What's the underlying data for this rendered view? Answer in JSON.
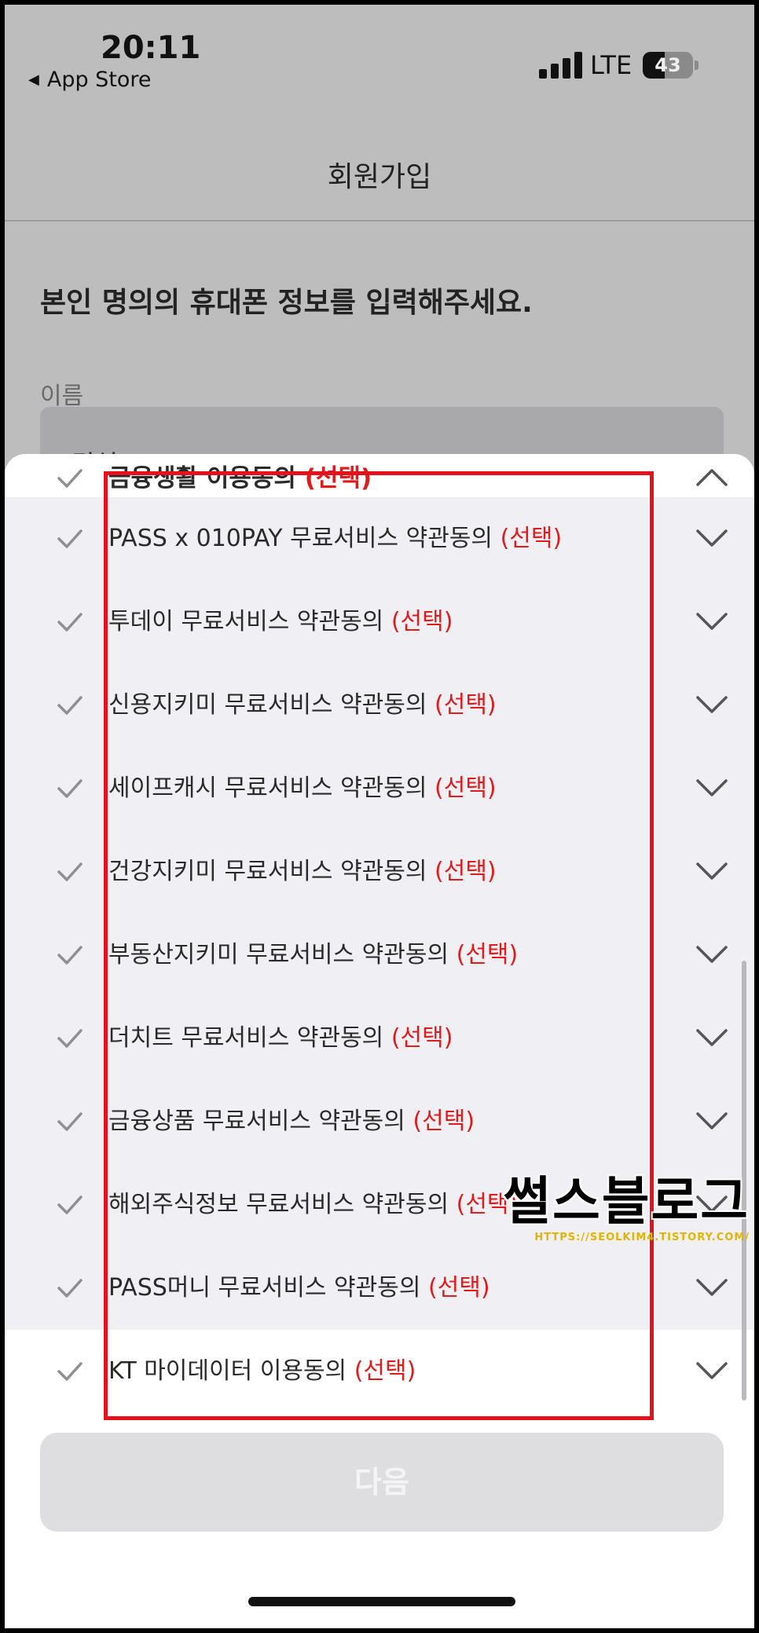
{
  "status_bar": {
    "time": "20:11",
    "back_app": "App Store",
    "network": "LTE",
    "battery": "43",
    "battery_level_percent": 43
  },
  "header": {
    "title": "회원가입"
  },
  "form": {
    "instruction": "본인 명의의 휴대폰 정보를 입력해주세요.",
    "name_label": "이름",
    "name_value": "김설"
  },
  "agreements": [
    {
      "label": "금융생활 이용동의",
      "tag": "(선택)",
      "expanded": true
    },
    {
      "label": "PASS x 010PAY 무료서비스 약관동의",
      "tag": "(선택)",
      "expanded": false
    },
    {
      "label": "투데이 무료서비스 약관동의",
      "tag": "(선택)",
      "expanded": false
    },
    {
      "label": "신용지키미 무료서비스 약관동의",
      "tag": "(선택)",
      "expanded": false
    },
    {
      "label": "세이프캐시 무료서비스 약관동의",
      "tag": "(선택)",
      "expanded": false
    },
    {
      "label": "건강지키미 무료서비스 약관동의",
      "tag": "(선택)",
      "expanded": false
    },
    {
      "label": "부동산지키미 무료서비스 약관동의",
      "tag": "(선택)",
      "expanded": false
    },
    {
      "label": "더치트 무료서비스 약관동의",
      "tag": "(선택)",
      "expanded": false
    },
    {
      "label": "금융상품 무료서비스 약관동의",
      "tag": "(선택)",
      "expanded": false
    },
    {
      "label": "해외주식정보 무료서비스 약관동의",
      "tag": "(선택)",
      "expanded": false
    },
    {
      "label": "PASS머니 무료서비스 약관동의",
      "tag": "(선택)",
      "expanded": false
    },
    {
      "label": "KT 마이데이터 이용동의",
      "tag": "(선택)",
      "expanded": false
    }
  ],
  "next_button": "다음",
  "watermark": {
    "title": "썰스블로그",
    "url": "HTTPS://SEOLKIM4.TISTORY.COM/"
  },
  "colors": {
    "optional_tag": "#e01b1b",
    "highlight_box": "#e3121c",
    "check": "#8e8e93"
  },
  "icons": {
    "check": "checkmark-icon",
    "expand": "chevron-down-icon",
    "collapse": "chevron-up-icon"
  }
}
